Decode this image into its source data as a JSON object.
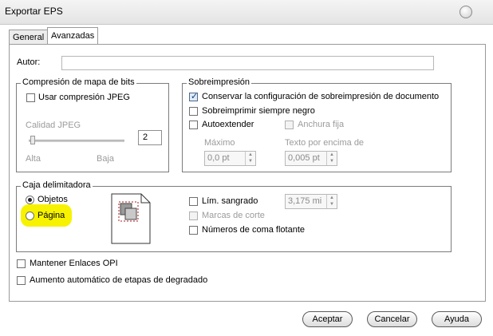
{
  "window": {
    "title": "Exportar EPS"
  },
  "tabs": [
    {
      "label": "General"
    },
    {
      "label": "Avanzadas"
    }
  ],
  "author": {
    "label": "Autor:",
    "value": ""
  },
  "bitmap": {
    "legend": "Compresión de mapa de bits",
    "use_jpeg": "Usar compresión JPEG",
    "quality_label": "Calidad JPEG",
    "quality_value": "2",
    "high": "Alta",
    "low": "Baja"
  },
  "overprint": {
    "legend": "Sobreimpresión",
    "keep_config": "Conservar la configuración de sobreimpresión de documento",
    "always_black": "Sobreimprimir siempre negro",
    "auto_extend": "Autoextender",
    "fixed_width": "Anchura fija",
    "max_label": "Máximo",
    "max_value": "0,0 pt",
    "text_above_label": "Texto por encima de",
    "text_above_value": "0,005 pt"
  },
  "bbox": {
    "legend": "Caja delimitadora",
    "objects": "Objetos",
    "page": "Página",
    "bleed_limit": "Lím. sangrado",
    "bleed_value": "3,175 mi",
    "crop_marks": "Marcas de corte",
    "float_numbers": "Números de coma flotante"
  },
  "options": {
    "keep_opi": "Mantener Enlaces OPI",
    "auto_gradient": "Aumento automático de etapas de degradado"
  },
  "buttons": {
    "accept": "Aceptar",
    "cancel": "Cancelar",
    "help": "Ayuda"
  },
  "colors": {
    "highlight": "#f7f200"
  }
}
